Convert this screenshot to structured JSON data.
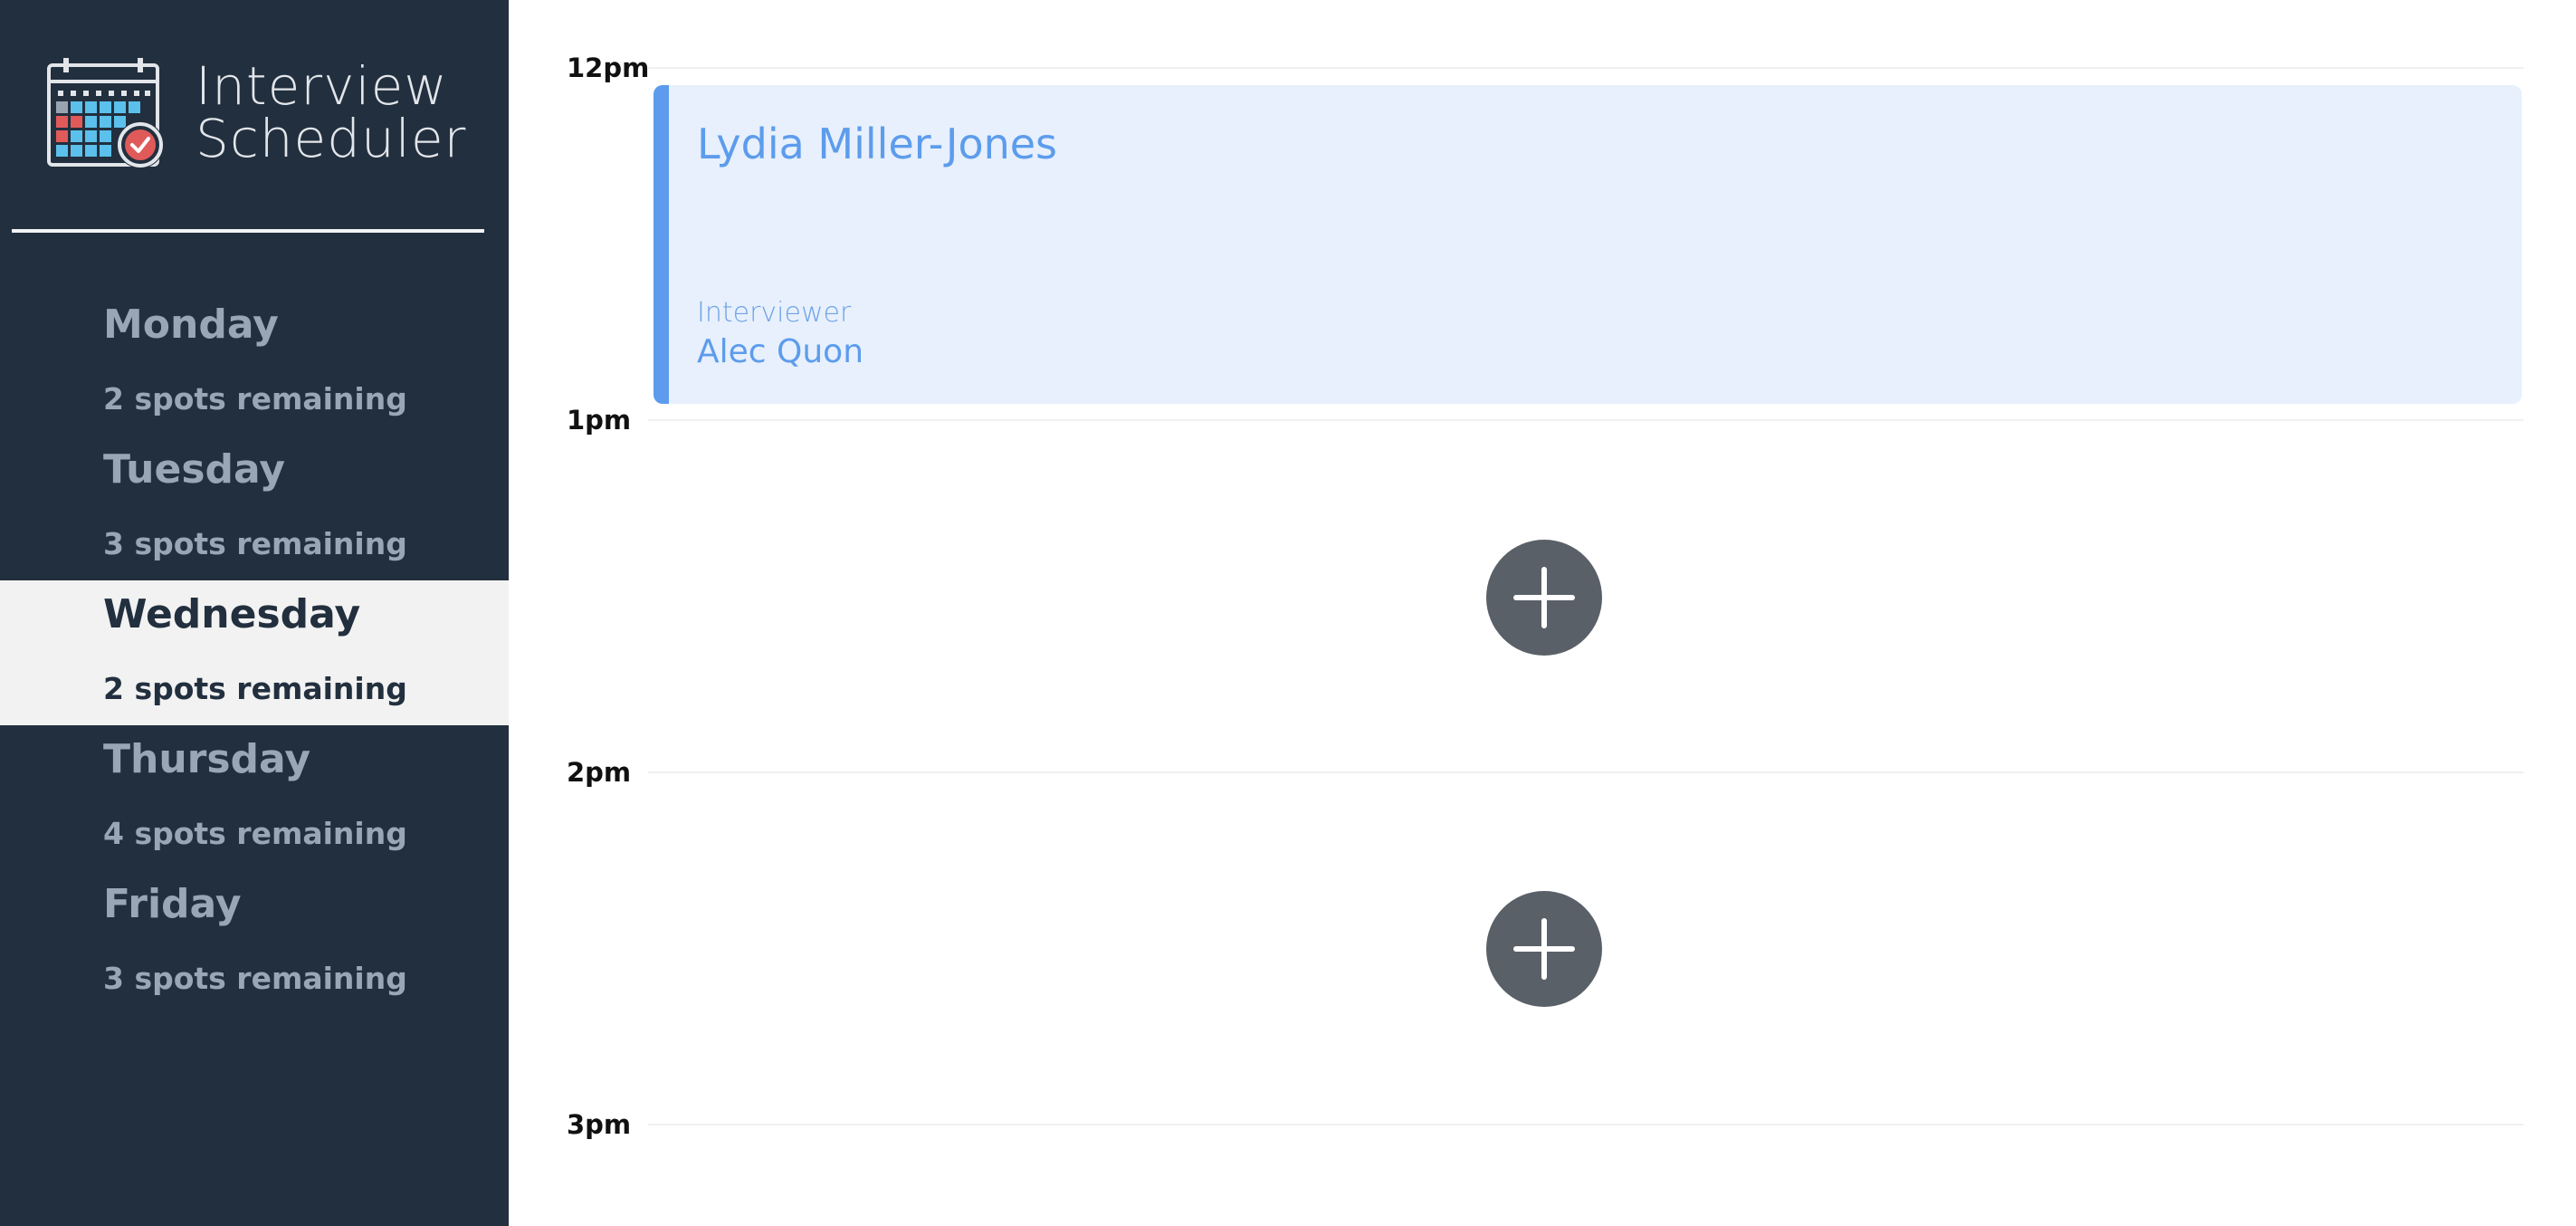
{
  "brand": {
    "line1": "Interview",
    "line2": "Scheduler",
    "logo_icon": "calendar-check-icon"
  },
  "sidebar": {
    "days": [
      {
        "name": "Monday",
        "spots": "2 spots remaining",
        "selected": false
      },
      {
        "name": "Tuesday",
        "spots": "3 spots remaining",
        "selected": false
      },
      {
        "name": "Wednesday",
        "spots": "2 spots remaining",
        "selected": true
      },
      {
        "name": "Thursday",
        "spots": "4 spots remaining",
        "selected": false
      },
      {
        "name": "Friday",
        "spots": "3 spots remaining",
        "selected": false
      }
    ]
  },
  "schedule": {
    "times": [
      "12pm",
      "1pm",
      "2pm",
      "3pm"
    ],
    "appointment": {
      "student": "Lydia Miller-Jones",
      "interviewer_label": "Interviewer",
      "interviewer": "Alec Quon"
    },
    "add_icon": "plus-icon"
  },
  "colors": {
    "sidebar_bg": "#222f3e",
    "selected_bg": "#f2f2f2",
    "accent": "#5d9cec",
    "appointment_bg": "#e7f0fc",
    "add_button": "#5a6068"
  }
}
